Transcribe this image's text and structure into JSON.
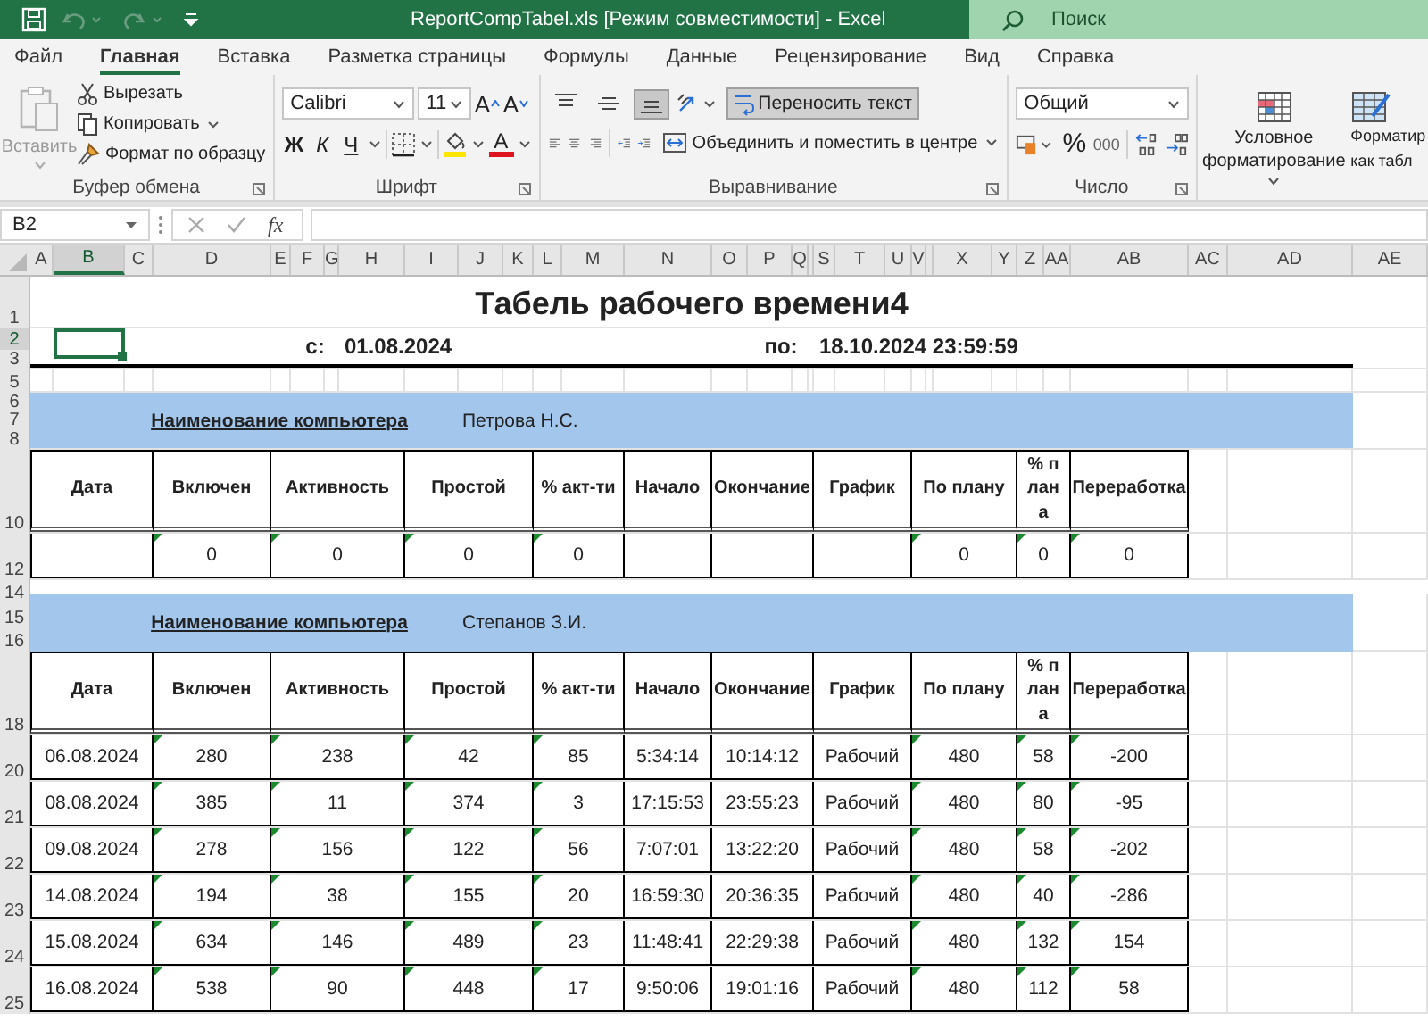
{
  "title_bar": {
    "title": "ReportCompTabel.xls  [Режим совместимости]  -  Excel",
    "search_placeholder": "Поиск"
  },
  "menu_tabs": [
    {
      "label": "Файл",
      "selected": false
    },
    {
      "label": "Главная",
      "selected": true
    },
    {
      "label": "Вставка",
      "selected": false
    },
    {
      "label": "Разметка страницы",
      "selected": false
    },
    {
      "label": "Формулы",
      "selected": false
    },
    {
      "label": "Данные",
      "selected": false
    },
    {
      "label": "Рецензирование",
      "selected": false
    },
    {
      "label": "Вид",
      "selected": false
    },
    {
      "label": "Справка",
      "selected": false
    }
  ],
  "ribbon": {
    "clipboard": {
      "paste": "Вставить",
      "cut": "Вырезать",
      "copy": "Копировать",
      "format_painter": "Формат по образцу",
      "group": "Буфер обмена"
    },
    "font": {
      "name": "Calibri",
      "size": "11",
      "grow": "A",
      "shrink": "A",
      "bold": "Ж",
      "italic": "К",
      "underline": "Ч",
      "font_color": "A",
      "group": "Шрифт"
    },
    "alignment": {
      "vertical_align": [
        {
          "selected": false
        },
        {
          "selected": false
        },
        {
          "selected": true
        }
      ],
      "wrap_text": {
        "label": "Переносить текст",
        "on": true
      },
      "merge": "Объединить и поместить в центре",
      "group": "Выравнивание"
    },
    "number": {
      "format": "Общий",
      "percent": "%",
      "thousands": "000",
      "group": "Число"
    },
    "styles": {
      "conditional": "Условное форматирование",
      "format_table_1": "Форматир",
      "format_table_2": "как табл"
    }
  },
  "formula_bar": {
    "cell": "B2",
    "function_label": "fx"
  },
  "sheet": {
    "columns": [
      {
        "letter": "A",
        "selected": false
      },
      {
        "letter": "B",
        "selected": true
      },
      {
        "letter": "C",
        "selected": false
      },
      {
        "letter": "D",
        "selected": false
      },
      {
        "letter": "E",
        "selected": false
      },
      {
        "letter": "F",
        "selected": false
      },
      {
        "letter": "G",
        "selected": false
      },
      {
        "letter": "H",
        "selected": false
      },
      {
        "letter": "I",
        "selected": false
      },
      {
        "letter": "J",
        "selected": false
      },
      {
        "letter": "K",
        "selected": false
      },
      {
        "letter": "L",
        "selected": false
      },
      {
        "letter": "M",
        "selected": false
      },
      {
        "letter": "N",
        "selected": false
      },
      {
        "letter": "O",
        "selected": false
      },
      {
        "letter": "P",
        "selected": false
      },
      {
        "letter": "Q",
        "selected": false
      },
      {
        "selected": false
      },
      {
        "letter": "S",
        "selected": false
      },
      {
        "letter": "T",
        "selected": false
      },
      {
        "letter": "U",
        "selected": false
      },
      {
        "letter": "V",
        "selected": false
      },
      {
        "selected": false
      },
      {
        "letter": "X",
        "selected": false
      },
      {
        "letter": "Y",
        "selected": false
      },
      {
        "letter": "Z",
        "selected": false
      },
      {
        "letter": "AA",
        "selected": false
      },
      {
        "letter": "AB",
        "selected": false
      },
      {
        "letter": "AC",
        "selected": false
      },
      {
        "letter": "AD",
        "selected": false
      },
      {
        "letter": "AE",
        "selected": false
      }
    ],
    "rows": [
      {
        "kind": "title",
        "numbers": [
          "1"
        ],
        "text": "Табель рабочего времени4"
      },
      {
        "kind": "dates",
        "numbers": [
          "2",
          "3"
        ],
        "selected_cell": true,
        "from_label": "с:",
        "from": "01.08.2024",
        "to_label": "по:",
        "to": "18.10.2024 23:59:59"
      },
      {
        "kind": "spacer",
        "numbers": [
          "5"
        ]
      },
      {
        "kind": "band",
        "numbers": [
          "6",
          "7",
          "8"
        ],
        "label": "Наименование компьютера",
        "name": "Петрова Н.С."
      },
      {
        "kind": "header",
        "numbers": [
          "10"
        ],
        "cells": [
          "Дата",
          "Включен",
          "Активность",
          "Простой",
          "% акт-ти",
          "Начало",
          "Окончание",
          "График",
          "По плану",
          "% плана",
          "Переработка"
        ]
      },
      {
        "kind": "data",
        "numbers": [
          "12"
        ],
        "cells": [
          null,
          {
            "text": "0",
            "flagged": true
          },
          {
            "text": "0",
            "flagged": true
          },
          {
            "text": "0",
            "flagged": true
          },
          {
            "text": "0",
            "flagged": true
          },
          null,
          null,
          null,
          {
            "text": "0",
            "flagged": true
          },
          {
            "text": "0",
            "flagged": true
          },
          {
            "text": "0",
            "flagged": true
          }
        ]
      },
      {
        "kind": "band",
        "numbers": [
          "14",
          "15",
          "16"
        ],
        "label": "Наименование компьютера",
        "name": "Степанов З.И."
      },
      {
        "kind": "header",
        "numbers": [
          "18"
        ],
        "cells": [
          "Дата",
          "Включен",
          "Активность",
          "Простой",
          "% акт-ти",
          "Начало",
          "Окончание",
          "График",
          "По плану",
          "% плана",
          "Переработка"
        ]
      },
      {
        "kind": "data",
        "numbers": [
          "20"
        ],
        "cells": [
          {
            "text": "06.08.2024",
            "flagged": false
          },
          {
            "text": "280",
            "flagged": true
          },
          {
            "text": "238",
            "flagged": true
          },
          {
            "text": "42",
            "flagged": true
          },
          {
            "text": "85",
            "flagged": true
          },
          {
            "text": "5:34:14",
            "flagged": false
          },
          {
            "text": "10:14:12",
            "flagged": false
          },
          {
            "text": "Рабочий",
            "flagged": false
          },
          {
            "text": "480",
            "flagged": true
          },
          {
            "text": "58",
            "flagged": true
          },
          {
            "text": "-200",
            "flagged": true
          }
        ]
      },
      {
        "kind": "data",
        "numbers": [
          "21"
        ],
        "cells": [
          {
            "text": "08.08.2024",
            "flagged": false
          },
          {
            "text": "385",
            "flagged": true
          },
          {
            "text": "11",
            "flagged": true
          },
          {
            "text": "374",
            "flagged": true
          },
          {
            "text": "3",
            "flagged": true
          },
          {
            "text": "17:15:53",
            "flagged": false
          },
          {
            "text": "23:55:23",
            "flagged": false
          },
          {
            "text": "Рабочий",
            "flagged": false
          },
          {
            "text": "480",
            "flagged": true
          },
          {
            "text": "80",
            "flagged": true
          },
          {
            "text": "-95",
            "flagged": true
          }
        ]
      },
      {
        "kind": "data",
        "numbers": [
          "22"
        ],
        "cells": [
          {
            "text": "09.08.2024",
            "flagged": false
          },
          {
            "text": "278",
            "flagged": true
          },
          {
            "text": "156",
            "flagged": true
          },
          {
            "text": "122",
            "flagged": true
          },
          {
            "text": "56",
            "flagged": true
          },
          {
            "text": "7:07:01",
            "flagged": false
          },
          {
            "text": "13:22:20",
            "flagged": false
          },
          {
            "text": "Рабочий",
            "flagged": false
          },
          {
            "text": "480",
            "flagged": true
          },
          {
            "text": "58",
            "flagged": true
          },
          {
            "text": "-202",
            "flagged": true
          }
        ]
      },
      {
        "kind": "data",
        "numbers": [
          "23"
        ],
        "cells": [
          {
            "text": "14.08.2024",
            "flagged": false
          },
          {
            "text": "194",
            "flagged": true
          },
          {
            "text": "38",
            "flagged": true
          },
          {
            "text": "155",
            "flagged": true
          },
          {
            "text": "20",
            "flagged": true
          },
          {
            "text": "16:59:30",
            "flagged": false
          },
          {
            "text": "20:36:35",
            "flagged": false
          },
          {
            "text": "Рабочий",
            "flagged": false
          },
          {
            "text": "480",
            "flagged": true
          },
          {
            "text": "40",
            "flagged": true
          },
          {
            "text": "-286",
            "flagged": true
          }
        ]
      },
      {
        "kind": "data",
        "numbers": [
          "24"
        ],
        "cells": [
          {
            "text": "15.08.2024",
            "flagged": false
          },
          {
            "text": "634",
            "flagged": true
          },
          {
            "text": "146",
            "flagged": true
          },
          {
            "text": "489",
            "flagged": true
          },
          {
            "text": "23",
            "flagged": true
          },
          {
            "text": "11:48:41",
            "flagged": false
          },
          {
            "text": "22:29:38",
            "flagged": false
          },
          {
            "text": "Рабочий",
            "flagged": false
          },
          {
            "text": "480",
            "flagged": true
          },
          {
            "text": "132",
            "flagged": true
          },
          {
            "text": "154",
            "flagged": true
          }
        ]
      },
      {
        "kind": "data",
        "numbers": [
          "25"
        ],
        "cells": [
          {
            "text": "16.08.2024",
            "flagged": false
          },
          {
            "text": "538",
            "flagged": true
          },
          {
            "text": "90",
            "flagged": true
          },
          {
            "text": "448",
            "flagged": true
          },
          {
            "text": "17",
            "flagged": true
          },
          {
            "text": "9:50:06",
            "flagged": false
          },
          {
            "text": "19:01:16",
            "flagged": false
          },
          {
            "text": "Рабочий",
            "flagged": false
          },
          {
            "text": "480",
            "flagged": true
          },
          {
            "text": "112",
            "flagged": true
          },
          {
            "text": "58",
            "flagged": true
          }
        ]
      }
    ]
  }
}
